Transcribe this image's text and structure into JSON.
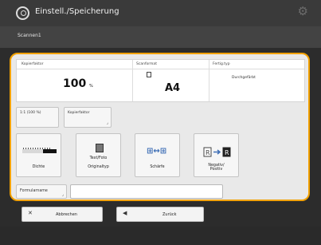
{
  "header": {
    "title": "Einstell./Speicherung",
    "subtitle": "Scannen1",
    "app_icon": "scan-store-icon",
    "settings_icon": "gear-icon"
  },
  "status": {
    "columns": [
      "Kopierfaktor",
      "Scanformat",
      "Fertig.typ"
    ],
    "zoom_value": "100",
    "zoom_unit": "%",
    "paper_size": "A4",
    "finishing": "Durchgefärbt"
  },
  "quick_buttons": [
    {
      "label": "1:1 (100 %)"
    },
    {
      "label": "Kopierfaktor"
    }
  ],
  "tiles": [
    {
      "label": "Dichte"
    },
    {
      "label": "Originaltyp",
      "caption": "Text/Foto"
    },
    {
      "label": "Schärfe"
    },
    {
      "label": "Negativ/\nPositiv"
    }
  ],
  "form": {
    "button_label": "Formularname",
    "input_value": ""
  },
  "bottom": {
    "cancel_label": "Abbrechen",
    "back_label": "Zurück"
  },
  "colors": {
    "accent": "#f2a100",
    "header_bg": "#3a3a3a",
    "panel_bg": "#e9e9e9",
    "sharpness_icon": "#3f6fb6"
  }
}
